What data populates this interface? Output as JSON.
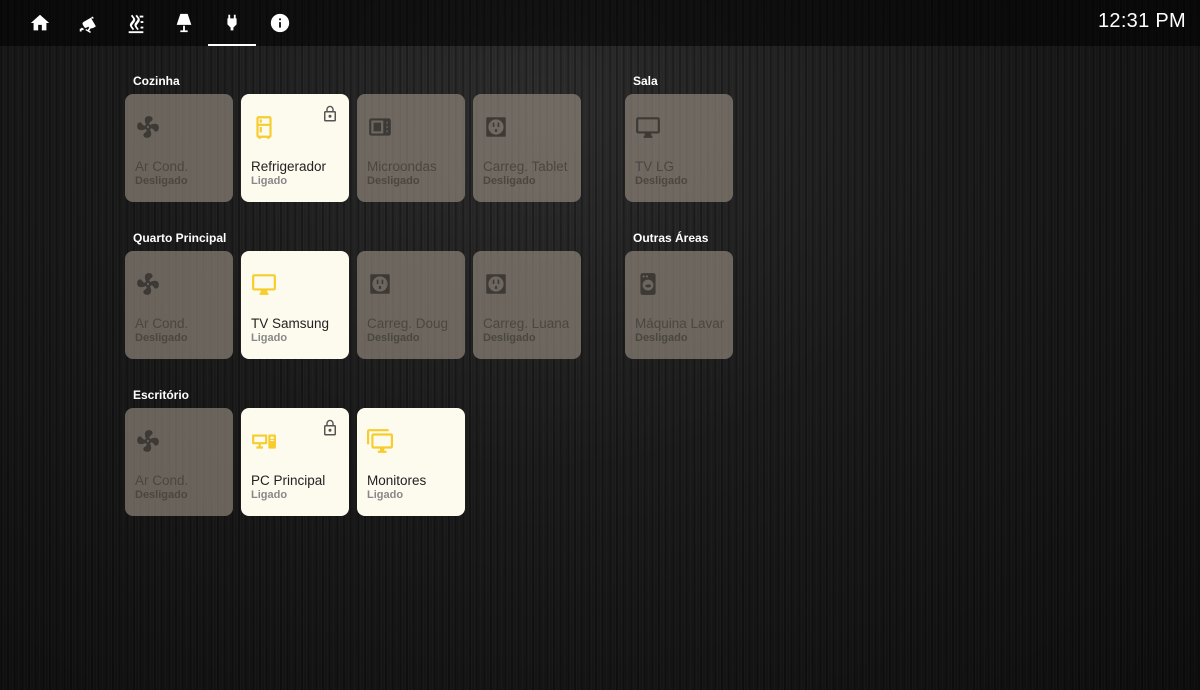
{
  "nav": {
    "tabs": [
      {
        "icon": "home-icon"
      },
      {
        "icon": "cctv-icon"
      },
      {
        "icon": "radiator-icon"
      },
      {
        "icon": "lamp-icon"
      },
      {
        "icon": "power-plug-icon",
        "active": true
      },
      {
        "icon": "info-icon"
      }
    ]
  },
  "clock": "12:31 PM",
  "colors": {
    "active_icon": "#f6cd2c",
    "card_on": "#fdfaee",
    "card_off": "rgba(150,140,128,0.65)"
  },
  "sections": {
    "cozinha": {
      "title": "Cozinha",
      "cards": [
        {
          "name": "Ar Cond.",
          "state": "Desligado",
          "icon": "fan-icon"
        },
        {
          "name": "Refrigerador",
          "state": "Ligado",
          "icon": "fridge-icon",
          "locked": true
        },
        {
          "name": "Microondas",
          "state": "Desligado",
          "icon": "microwave-icon"
        },
        {
          "name": "Carreg. Tablet",
          "state": "Desligado",
          "icon": "power-socket-icon"
        }
      ]
    },
    "sala": {
      "title": "Sala",
      "cards": [
        {
          "name": "TV LG",
          "state": "Desligado",
          "icon": "tv-icon"
        }
      ]
    },
    "quarto": {
      "title": "Quarto Principal",
      "cards": [
        {
          "name": "Ar Cond.",
          "state": "Desligado",
          "icon": "fan-icon"
        },
        {
          "name": "TV Samsung",
          "state": "Ligado",
          "icon": "tv-icon"
        },
        {
          "name": "Carreg. Doug",
          "state": "Desligado",
          "icon": "power-socket-icon"
        },
        {
          "name": "Carreg. Luana",
          "state": "Desligado",
          "icon": "power-socket-icon"
        }
      ]
    },
    "outras": {
      "title": "Outras Áreas",
      "cards": [
        {
          "name": "Máquina Lavar",
          "state": "Desligado",
          "icon": "washing-machine-icon"
        }
      ]
    },
    "escritorio": {
      "title": "Escritório",
      "cards": [
        {
          "name": "Ar Cond.",
          "state": "Desligado",
          "icon": "fan-icon"
        },
        {
          "name": "PC Principal",
          "state": "Ligado",
          "icon": "desktop-tower-icon",
          "locked": true
        },
        {
          "name": "Monitores",
          "state": "Ligado",
          "icon": "monitor-multiple-icon"
        }
      ]
    }
  }
}
